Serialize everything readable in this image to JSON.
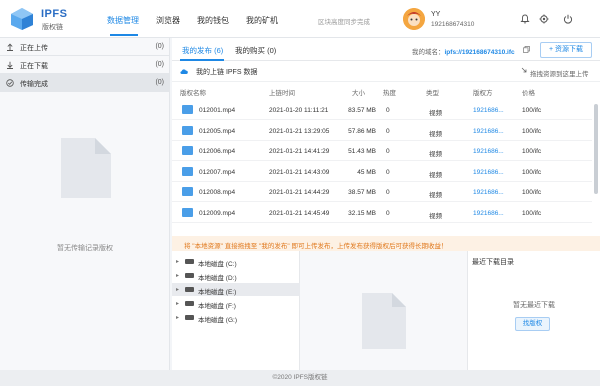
{
  "brand": {
    "title": "IPFS",
    "subtitle": "版权链"
  },
  "nav": [
    {
      "label": "数据管理",
      "active": true
    },
    {
      "label": "浏览器"
    },
    {
      "label": "我的钱包"
    },
    {
      "label": "我的矿机"
    }
  ],
  "sync_status": "区块高度同步完成",
  "user": {
    "name": "YY",
    "phone": "192168674310"
  },
  "header_icons": [
    "bell-icon",
    "gear-icon",
    "power-icon"
  ],
  "tasks": [
    {
      "label": "正在上传",
      "count": "(0)",
      "icon": "upload-icon"
    },
    {
      "label": "正在下载",
      "count": "(0)",
      "icon": "download-icon"
    },
    {
      "label": "传输完成",
      "count": "(0)",
      "icon": "check-icon"
    }
  ],
  "left_empty_text": "暂无传输记录版权",
  "tabs": [
    {
      "label": "我的发布 (6)",
      "active": true
    },
    {
      "label": "我的购买 (0)"
    }
  ],
  "domain": {
    "label": "我的域名：",
    "value": "ipfs://192168674310.ifc"
  },
  "publish_button": "+ 资源下载",
  "sub_label": "我的上链 IPFS 数据",
  "drag_hint": "拖拽资源到这里上传",
  "columns": [
    "版权名称",
    "上链时间",
    "大小",
    "热度",
    "类型",
    "版权方",
    "价格"
  ],
  "rows": [
    [
      "012001.mp4",
      "2021-01-20 11:11:21",
      "83.57 MB",
      "0",
      "视频",
      "1921686...",
      "100/ifc"
    ],
    [
      "012005.mp4",
      "2021-01-21 13:29:05",
      "57.86 MB",
      "0",
      "视频",
      "1921686...",
      "100/ifc"
    ],
    [
      "012006.mp4",
      "2021-01-21 14:41:29",
      "51.43 MB",
      "0",
      "视频",
      "1921686...",
      "100/ifc"
    ],
    [
      "012007.mp4",
      "2021-01-21 14:43:09",
      "45 MB",
      "0",
      "视频",
      "1921686...",
      "100/ifc"
    ],
    [
      "012008.mp4",
      "2021-01-21 14:44:29",
      "38.57 MB",
      "0",
      "视频",
      "1921686...",
      "100/ifc"
    ],
    [
      "012009.mp4",
      "2021-01-21 14:45:49",
      "32.15 MB",
      "0",
      "视频",
      "1921686...",
      "100/ifc"
    ]
  ],
  "notice": "将 \"本地资源\" 直接拖拽至 \"我的发布\" 即可上传发布，上传发布获得版权后可获得长期收益！",
  "drives": [
    {
      "label": "本地磁盘 (C:)"
    },
    {
      "label": "本地磁盘 (D:)"
    },
    {
      "label": "本地磁盘 (E:)",
      "active": true
    },
    {
      "label": "本地磁盘 (F:)"
    },
    {
      "label": "本地磁盘 (G:)"
    }
  ],
  "recent_title": "最近下载目录",
  "recent_empty": "暂无最近下载",
  "find_button": "找版权",
  "footer": "©2020 IPFS版权链",
  "colors": {
    "accent": "#1e88e5",
    "notice_text": "#e0781c",
    "notice_bg": "#fdf1e4"
  }
}
